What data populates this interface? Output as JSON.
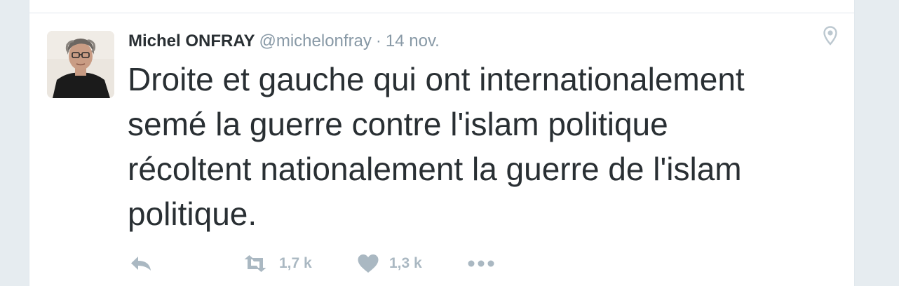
{
  "tweet": {
    "author_name": "Michel ONFRAY",
    "author_handle": "@michelonfray",
    "separator": "·",
    "timestamp": "14 nov.",
    "text": "Droite et gauche qui ont internationalement\nsemé la guerre contre l'islam politique\nrécoltent nationalement la guerre de l'islam\npolitique.",
    "avatar_icon": "author-photo",
    "location_icon": "location-pin-icon"
  },
  "actions": {
    "reply_icon": "reply-icon",
    "retweet_icon": "retweet-icon",
    "retweet_count": "1,7 k",
    "like_icon": "heart-icon",
    "like_count": "1,3 k",
    "more_icon": "more-dots-icon"
  },
  "colors": {
    "page_background": "#e6ecf0",
    "card_background": "#ffffff",
    "text_primary": "#292f33",
    "text_secondary": "#8899a6",
    "action_gray": "#aab8c2",
    "border": "#e1e8ed"
  }
}
